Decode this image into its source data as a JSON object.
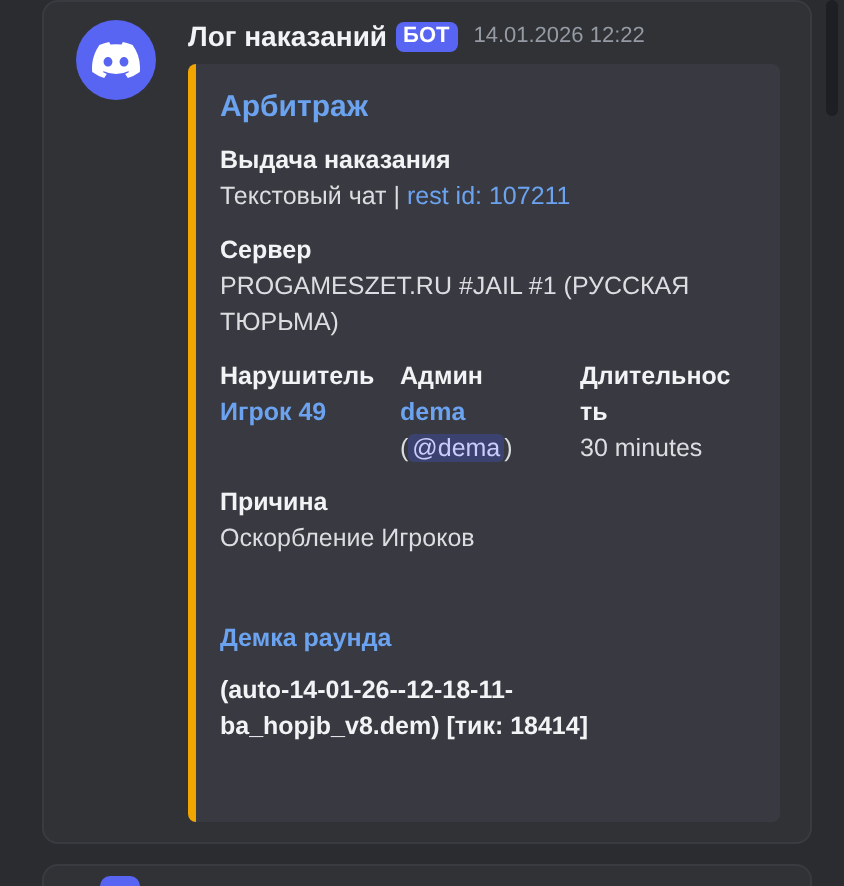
{
  "message": {
    "author": "Лог наказаний",
    "badge": "БОТ",
    "timestamp": "14.01.2026 12:22",
    "embed": {
      "title": "Арбитраж",
      "fields": [
        {
          "name": "Выдача наказания",
          "inline": false,
          "value": [
            {
              "kind": "text",
              "text": "Текстовый чат | "
            },
            {
              "kind": "link",
              "text": "rest id: 107211"
            }
          ]
        },
        {
          "name": "Сервер",
          "inline": false,
          "value": [
            {
              "kind": "text",
              "text": "PROGAMESZET.RU #JAIL #1 (РУССКАЯ ТЮРЬМА)"
            }
          ]
        },
        {
          "name": "Нарушитель",
          "inline": true,
          "value": [
            {
              "kind": "bold_link",
              "text": "Игрок 49"
            }
          ]
        },
        {
          "name": "Админ",
          "inline": true,
          "value": [
            {
              "kind": "bold_link",
              "text": "dema"
            },
            {
              "kind": "text",
              "text": "("
            },
            {
              "kind": "mention",
              "text": "@dema"
            },
            {
              "kind": "text",
              "text": ")"
            }
          ]
        },
        {
          "name": "Длительность",
          "inline": true,
          "value": [
            {
              "kind": "text",
              "text": "30 minutes"
            }
          ]
        },
        {
          "name": "Причина",
          "inline": false,
          "value": [
            {
              "kind": "text",
              "text": "Оскорбление Игроков"
            }
          ]
        }
      ],
      "demo": {
        "title": "Демка раунда",
        "text": "(auto-14-01-26--12-18-11-ba_hopjb_v8.dem) [тик: 18414]"
      }
    }
  }
}
